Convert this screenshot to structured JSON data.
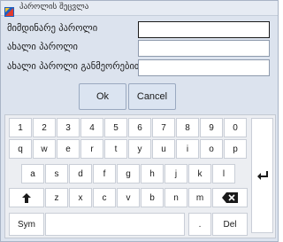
{
  "window": {
    "title": "პაროლის შეცვლა"
  },
  "form": {
    "current_password_label": "მიმდინარე პაროლი",
    "new_password_label": "ახალი პაროლი",
    "confirm_password_label": "ახალი პაროლი განმეორებით",
    "current_password_value": "",
    "new_password_value": "",
    "confirm_password_value": ""
  },
  "buttons": {
    "ok": "Ok",
    "cancel": "Cancel"
  },
  "keyboard": {
    "row1": [
      "1",
      "2",
      "3",
      "4",
      "5",
      "6",
      "7",
      "8",
      "9",
      "0"
    ],
    "row2": [
      "q",
      "w",
      "e",
      "r",
      "t",
      "y",
      "u",
      "i",
      "o",
      "p"
    ],
    "row3": [
      "a",
      "s",
      "d",
      "f",
      "g",
      "h",
      "j",
      "k",
      "l"
    ],
    "row4": [
      "z",
      "x",
      "c",
      "v",
      "b",
      "n",
      "m"
    ],
    "sym": "Sym",
    "dot": ".",
    "del": "Del"
  },
  "colors": {
    "window_bg": "#dce3ee",
    "keyboard_bg": "#eceef2",
    "key_bg": "#ffffff"
  },
  "icons": {
    "app": "app-icon",
    "shift": "shift-up-arrow-icon",
    "backspace": "backspace-icon",
    "enter": "enter-return-icon"
  }
}
